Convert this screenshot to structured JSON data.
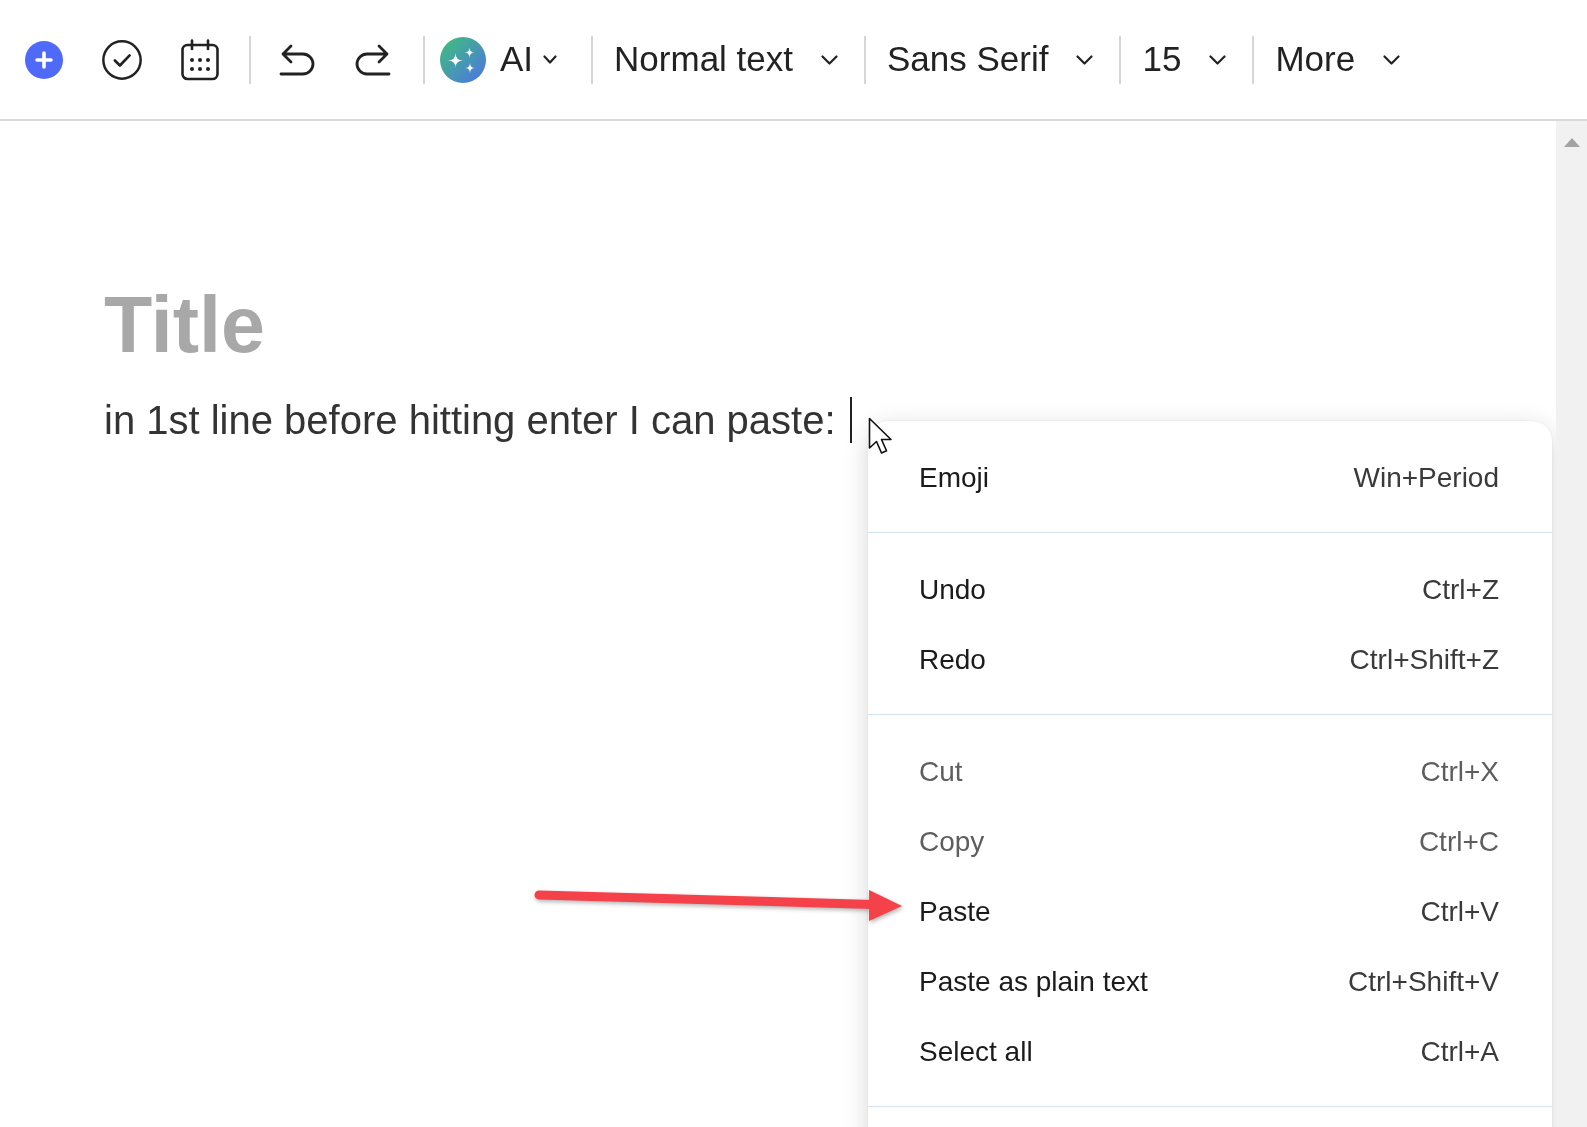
{
  "toolbar": {
    "groups": [
      {
        "items": [
          {
            "kind": "plus"
          },
          {
            "kind": "check"
          },
          {
            "kind": "calendar"
          }
        ]
      },
      {
        "items": [
          {
            "kind": "undo"
          },
          {
            "kind": "redo"
          }
        ]
      },
      {
        "items": [
          {
            "kind": "ai",
            "label": "AI"
          }
        ]
      },
      {
        "items": [
          {
            "kind": "dropdown",
            "label": "Normal text"
          }
        ]
      },
      {
        "items": [
          {
            "kind": "dropdown",
            "label": "Sans Serif"
          }
        ]
      },
      {
        "items": [
          {
            "kind": "dropdown",
            "label": "15"
          }
        ]
      },
      {
        "items": [
          {
            "kind": "dropdown",
            "label": "More"
          }
        ]
      }
    ]
  },
  "document": {
    "title": {
      "placeholder": "Title"
    },
    "body_text": "in 1st line before hitting enter I can paste:"
  },
  "context_menu": {
    "groups": [
      {
        "items": [
          {
            "label": "Emoji",
            "shortcut": "Win+Period",
            "disabled": false,
            "annotated": false
          }
        ]
      },
      {
        "items": [
          {
            "label": "Undo",
            "shortcut": "Ctrl+Z",
            "disabled": false,
            "annotated": false
          },
          {
            "label": "Redo",
            "shortcut": "Ctrl+Shift+Z",
            "disabled": false,
            "annotated": false
          }
        ]
      },
      {
        "items": [
          {
            "label": "Cut",
            "shortcut": "Ctrl+X",
            "disabled": true,
            "annotated": false
          },
          {
            "label": "Copy",
            "shortcut": "Ctrl+C",
            "disabled": true,
            "annotated": false
          },
          {
            "label": "Paste",
            "shortcut": "Ctrl+V",
            "disabled": false,
            "annotated": true
          },
          {
            "label": "Paste as plain text",
            "shortcut": "Ctrl+Shift+V",
            "disabled": false,
            "annotated": false
          },
          {
            "label": "Select all",
            "shortcut": "Ctrl+A",
            "disabled": false,
            "annotated": false
          }
        ]
      }
    ]
  }
}
